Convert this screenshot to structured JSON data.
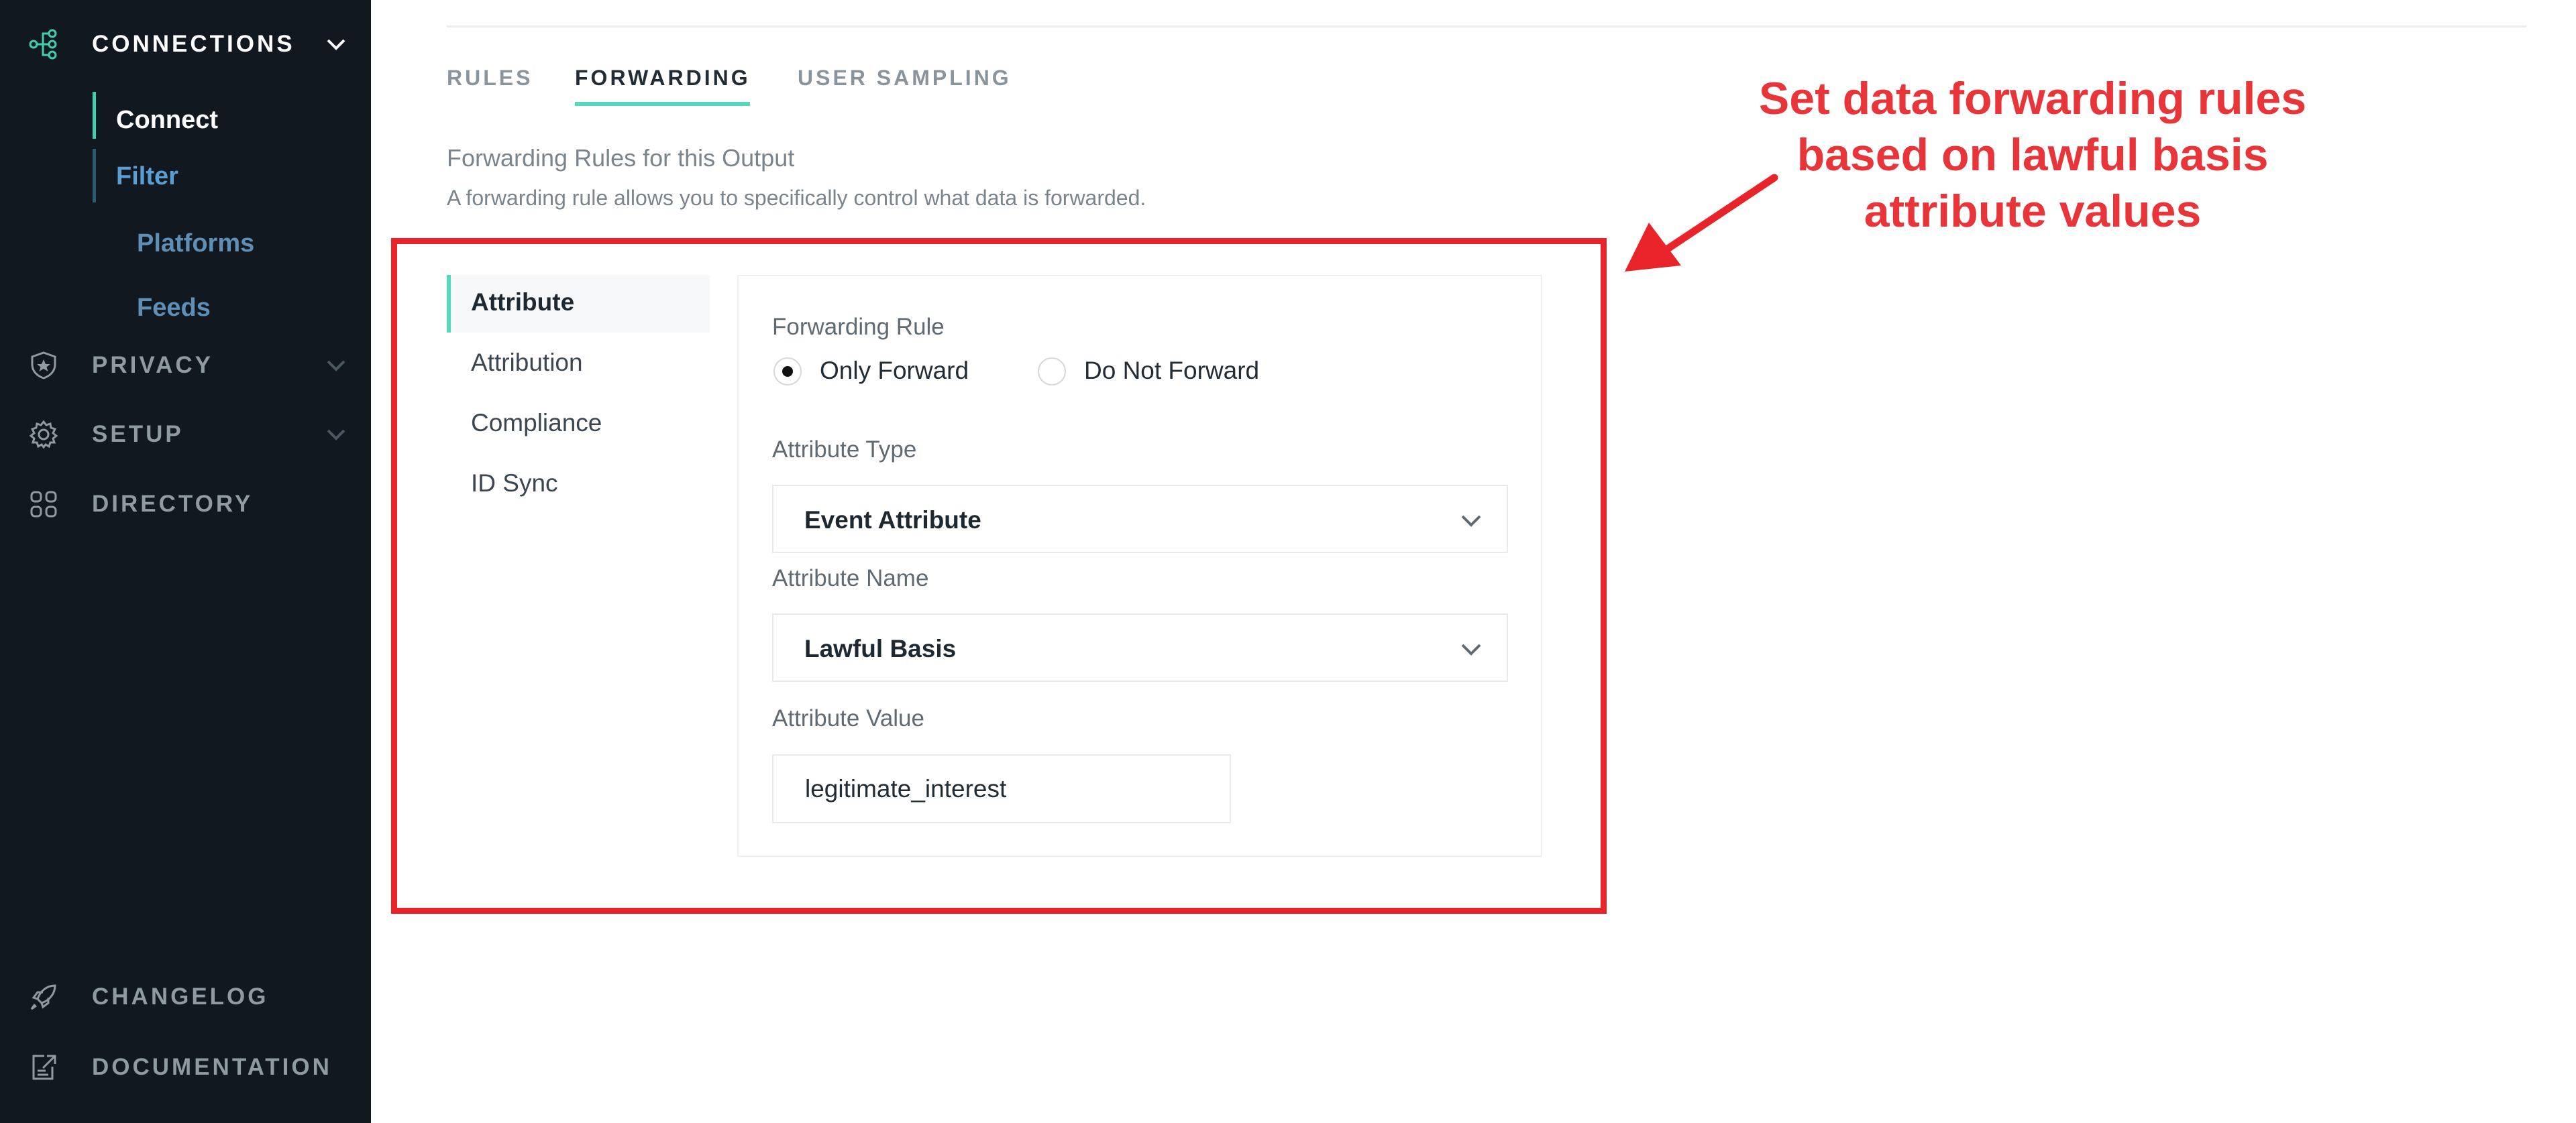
{
  "sidebar": {
    "connections": {
      "label": "CONNECTIONS",
      "icon": "connections-icon"
    },
    "connections_subitems": [
      "Connect",
      "Filter"
    ],
    "output_subitems": [
      "Platforms",
      "Feeds"
    ],
    "privacy": {
      "label": "PRIVACY",
      "icon": "shield-star-icon"
    },
    "setup": {
      "label": "SETUP",
      "icon": "gear-icon"
    },
    "directory": {
      "label": "DIRECTORY",
      "icon": "grid-icon"
    },
    "changelog": {
      "label": "CHANGELOG",
      "icon": "rocket-icon"
    },
    "documentation": {
      "label": "DOCUMENTATION",
      "icon": "document-link-icon"
    }
  },
  "tabs": [
    "RULES",
    "FORWARDING",
    "USER SAMPLING"
  ],
  "active_tab": "FORWARDING",
  "section": {
    "title": "Forwarding Rules for this Output",
    "description": "A forwarding rule allows you to specifically control what data is forwarded."
  },
  "rule_types": [
    "Attribute",
    "Attribution",
    "Compliance",
    "ID Sync"
  ],
  "active_rule_type": "Attribute",
  "form": {
    "forwarding_rule_label": "Forwarding Rule",
    "options": [
      "Only Forward",
      "Do Not Forward"
    ],
    "selected_option": "Only Forward",
    "attribute_type_label": "Attribute Type",
    "attribute_type_value": "Event Attribute",
    "attribute_name_label": "Attribute Name",
    "attribute_name_value": "Lawful Basis",
    "attribute_value_label": "Attribute Value",
    "attribute_value": "legitimate_interest"
  },
  "annotation": {
    "lines": [
      "Set data forwarding rules",
      "based on lawful basis",
      "attribute values"
    ]
  },
  "colors": {
    "sidebar_bg": "#11181f",
    "accent": "#56d8bd",
    "annotation_red": "#e8242a"
  }
}
